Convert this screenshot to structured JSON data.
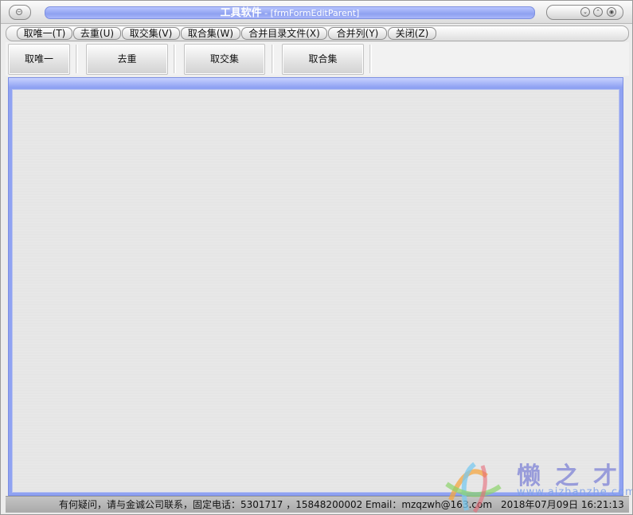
{
  "window": {
    "title_main": "工具软件",
    "title_sub": " - [frmFormEditParent]"
  },
  "menu": [
    {
      "label": "取唯一(T)"
    },
    {
      "label": "去重(U)"
    },
    {
      "label": "取交集(V)"
    },
    {
      "label": "取合集(W)"
    },
    {
      "label": "合并目录文件(X)"
    },
    {
      "label": "合并列(Y)"
    },
    {
      "label": "关闭(Z)"
    }
  ],
  "toolbar": [
    {
      "label": "取唯一"
    },
    {
      "label": "去重"
    },
    {
      "label": "取交集"
    },
    {
      "label": "取合集"
    }
  ],
  "status": {
    "contact": "有何疑问，请与金诚公司联系，固定电话：5301717 ，15848200002 Email：mzqzwh@163.com",
    "datetime": "2018年07月09日 16:21:13"
  },
  "watermark": {
    "text": "懒之才",
    "domain": "www.aizhanzhe.com"
  },
  "colors": {
    "accent": "#8ea1f2",
    "statusbar": "#b4b4b4"
  }
}
